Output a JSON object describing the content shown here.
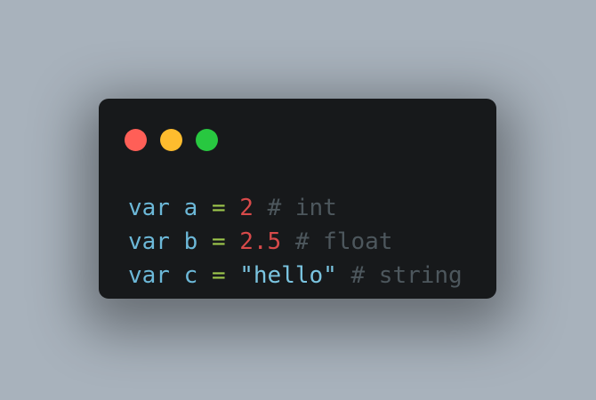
{
  "window": {
    "controls": [
      {
        "name": "close",
        "color": "#ff5f57"
      },
      {
        "name": "minimize",
        "color": "#febc2e"
      },
      {
        "name": "maximize",
        "color": "#28c840"
      }
    ]
  },
  "code": {
    "lines": [
      {
        "keyword": "var",
        "ident": "a",
        "op": "=",
        "value": "2",
        "value_type": "num",
        "comment": "# int"
      },
      {
        "keyword": "var",
        "ident": "b",
        "op": "=",
        "value": "2.5",
        "value_type": "num",
        "comment": "# float"
      },
      {
        "keyword": "var",
        "ident": "c",
        "op": "=",
        "value": "\"hello\"",
        "value_type": "str",
        "comment": "# string"
      }
    ]
  }
}
